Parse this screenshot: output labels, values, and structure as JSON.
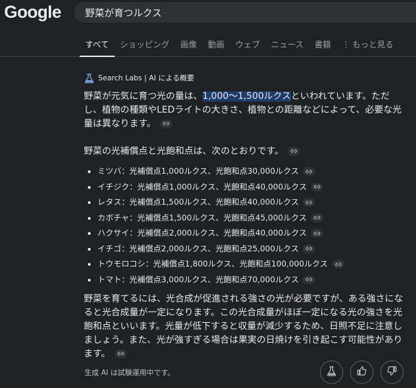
{
  "header": {
    "logo": "Google",
    "search_query": "野菜が育つルクス"
  },
  "tabs": [
    {
      "label": "すべて",
      "active": true
    },
    {
      "label": "ショッピング"
    },
    {
      "label": "画像"
    },
    {
      "label": "動画"
    },
    {
      "label": "ウェブ"
    },
    {
      "label": "ニュース"
    },
    {
      "label": "書籍"
    },
    {
      "label": "もっと見る"
    }
  ],
  "ai_overview": {
    "header_label": "Search Labs | AI による概要",
    "intro_before": "野菜が元気に育つ光の量は、",
    "intro_highlight": "1,000～1,500ルクス",
    "intro_after": "といわれています。ただし、植物の種類やLEDライトの大きさ、植物との距離などによって、必要な光量は異なります。",
    "list_heading": "野菜の光補償点と光飽和点は、次のとおりです。",
    "list_items": [
      "ミツバ：光補償点1,000ルクス、光飽和点30,000ルクス",
      "イチジク：光補償点1,000ルクス、光飽和点40,000ルクス",
      "レタス：光補償点1,500ルクス、光飽和点40,000ルクス",
      "カボチャ：光補償点1,500ルクス、光飽和点45,000ルクス",
      "ハクサイ：光補償点2,000ルクス、光飽和点40,000ルクス",
      "イチゴ：光補償点2,000ルクス、光飽和点25,000ルクス",
      "トウモロコシ：光補償点1,800ルクス、光飽和点100,000ルクス",
      "トマト：光補償点3,000ルクス、光飽和点70,000ルクス"
    ],
    "closing": "野菜を育てるには、光合成が促進される強さの光が必要ですが、ある強さになると光合成量が一定になります。この光合成量がほぼ一定になる光の強さを光飽和点といいます。光量が低下すると収量が減少するため、日照不足に注意しましょう。また、光が強すぎる場合は果実の日焼けを引き起こす可能性があります。",
    "footer_note": "生成 AI は試験運用中です。"
  },
  "colors": {
    "background": "#202124",
    "highlight": "#1f3b6b",
    "flask_icon": "#8ab4f8",
    "text": "#e8eaed"
  },
  "icons": [
    "flask-icon",
    "link-icon",
    "thumbs-up-icon",
    "thumbs-down-icon"
  ]
}
